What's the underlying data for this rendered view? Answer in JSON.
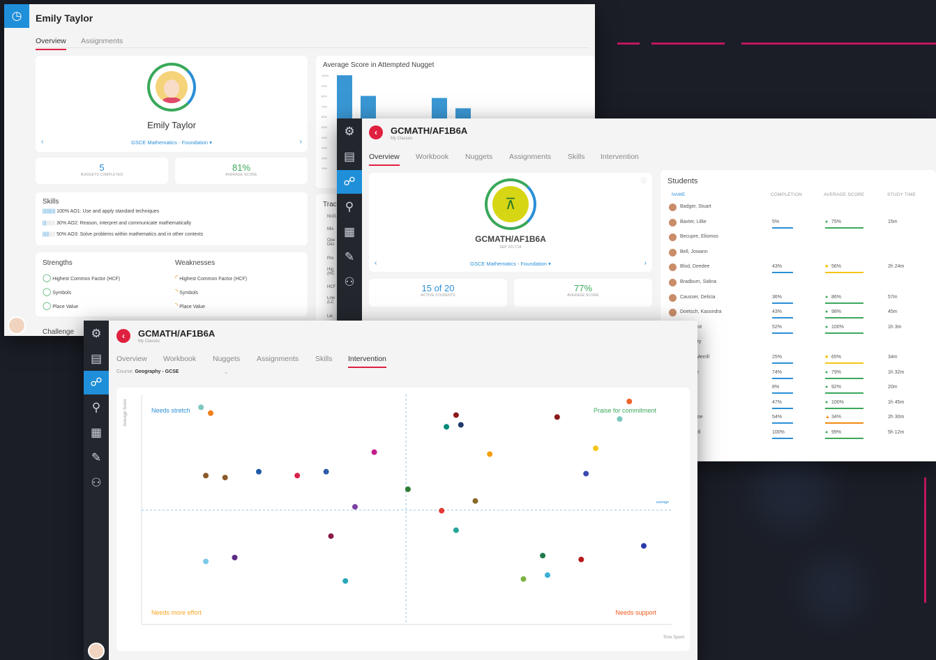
{
  "colors": {
    "accent": "#e0203f",
    "blue": "#2b8fd6",
    "green": "#3aa85a",
    "orange": "#f08c12"
  },
  "win1": {
    "title": "Emily Taylor",
    "tabs": [
      "Overview",
      "Assignments"
    ],
    "profile_name": "Emily Taylor",
    "course": "GSCE Mathematics - Foundation ▾",
    "stats": [
      {
        "value": "5",
        "label": "NUGGETS COMPLETED"
      },
      {
        "value": "81%",
        "label": "AVERAGE SCORE"
      }
    ],
    "skills_title": "Skills",
    "skills": [
      {
        "pct": "100%",
        "text": "AO1: Use and apply standard techniques"
      },
      {
        "pct": "30%",
        "text": "AO2: Reason, interpret and communicate mathematically"
      },
      {
        "pct": "50%",
        "text": "AO3: Solve problems within mathematics and in other contexts"
      }
    ],
    "strengths_title": "Strengths",
    "strengths": [
      "Highest Common Factor (HCF)",
      "Symbols",
      "Place Value"
    ],
    "weaknesses_title": "Weaknesses",
    "weaknesses": [
      "Highest Common Factor (HCF)",
      "Symbols",
      "Place Value"
    ],
    "challenge": "Challenge",
    "chart_title": "Average Score in Attempted Nugget",
    "chart_ticks": [
      "100%",
      "90%",
      "80%",
      "70%",
      "60%",
      "50%",
      "40%",
      "30%",
      "20%",
      "10%"
    ],
    "side_title": "Trac",
    "side_rows": [
      "NUG",
      "Mix",
      "Ope Dec",
      "Pre",
      "Hig (HC",
      "HCF",
      "Low (LC",
      "Lie"
    ]
  },
  "win2": {
    "title": "GCMATH/AF1B6A",
    "subtitle": "My Classes",
    "tabs": [
      "Overview",
      "Workbook",
      "Nuggets",
      "Assignments",
      "Skills",
      "Intervention"
    ],
    "class_name": "GCMATH/AF1B6A",
    "class_year": "SEP 2017/18",
    "course": "GSCE Mathematics - Foundation ▾",
    "stats": [
      {
        "value": "15 of 20",
        "label": "ACTIVE STUDENTS"
      },
      {
        "value": "77%",
        "label": "AVERAGE SCORE"
      }
    ],
    "students_title": "Students",
    "columns": [
      "NAME",
      "COMPLETION",
      "AVERAGE SCORE",
      "STUDY TIME"
    ],
    "students": [
      {
        "name": "Badger, Stuart",
        "comp": "",
        "score": "",
        "time": "",
        "st": ""
      },
      {
        "name": "Baxter, Lillie",
        "comp": "5%",
        "score": "75%",
        "time": "15m",
        "st": "green"
      },
      {
        "name": "Becupre, Eliomos",
        "comp": "",
        "score": "",
        "time": "",
        "st": ""
      },
      {
        "name": "Bell, Jowann",
        "comp": "",
        "score": "",
        "time": "",
        "st": ""
      },
      {
        "name": "Blod, Deedee",
        "comp": "43%",
        "score": "56%",
        "time": "2h 24m",
        "st": "yellow"
      },
      {
        "name": "Bradburn, Sidina",
        "comp": "",
        "score": "",
        "time": "",
        "st": ""
      },
      {
        "name": "Causser, Delicia",
        "comp": "36%",
        "score": "86%",
        "time": "57m",
        "st": "green"
      },
      {
        "name": "Doetsch, Kasondra",
        "comp": "43%",
        "score": "98%",
        "time": "45m",
        "st": "green"
      },
      {
        "name": "...ke, Scot",
        "comp": "52%",
        "score": "100%",
        "time": "1h 3m",
        "st": "green"
      },
      {
        "name": "...n, Barry",
        "comp": "",
        "score": "",
        "time": "",
        "st": ""
      },
      {
        "name": "...ding, Merrill",
        "comp": "25%",
        "score": "65%",
        "time": "34m",
        "st": "yellow"
      },
      {
        "name": "..., Liane",
        "comp": "74%",
        "score": "79%",
        "time": "1h 32m",
        "st": "green"
      },
      {
        "name": "Edward",
        "comp": "8%",
        "score": "92%",
        "time": "20m",
        "st": "green"
      },
      {
        "name": "...Kirk",
        "comp": "47%",
        "score": "100%",
        "time": "1h 45m",
        "st": "green"
      },
      {
        "name": "...ore, Noe",
        "comp": "54%",
        "score": "34%",
        "time": "2h 30m",
        "st": "orange"
      },
      {
        "name": "..., Jewell",
        "comp": "100%",
        "score": "99%",
        "time": "5h 12m",
        "st": "green"
      }
    ]
  },
  "win3": {
    "title": "GCMATH/AF1B6A",
    "subtitle": "My Classes",
    "tabs": [
      "Overview",
      "Workbook",
      "Nuggets",
      "Assignments",
      "Skills",
      "Intervention"
    ],
    "course_label": "Course:",
    "course_value": "Geography - GCSE",
    "y_label": "Average Score",
    "x_label": "Time Spent",
    "avg_label": "average",
    "quadrants": {
      "tl": "Needs stretch",
      "tr": "Praise for commitment",
      "bl": "Needs more effort",
      "br": "Needs support"
    }
  },
  "chart_data": [
    {
      "type": "bar",
      "title": "Average Score in Attempted Nugget",
      "ylim": [
        0,
        100
      ],
      "values": [
        100,
        80,
        50,
        0,
        78,
        68
      ]
    },
    {
      "type": "scatter",
      "xlabel": "Time Spent",
      "ylabel": "Average Score",
      "points": [
        {
          "x": 0.08,
          "y": 0.97,
          "c": "#7cc8c0"
        },
        {
          "x": 0.1,
          "y": 0.94,
          "c": "#f07f1d"
        },
        {
          "x": 0.09,
          "y": 0.62,
          "c": "#8a5a2a"
        },
        {
          "x": 0.13,
          "y": 0.61,
          "c": "#8a5a2a"
        },
        {
          "x": 0.2,
          "y": 0.64,
          "c": "#1f5aa8"
        },
        {
          "x": 0.28,
          "y": 0.62,
          "c": "#d6224a"
        },
        {
          "x": 0.34,
          "y": 0.64,
          "c": "#2a5ca8"
        },
        {
          "x": 0.4,
          "y": 0.46,
          "c": "#7a3fa0"
        },
        {
          "x": 0.44,
          "y": 0.74,
          "c": "#c21f8a"
        },
        {
          "x": 0.51,
          "y": 0.55,
          "c": "#2e7d32"
        },
        {
          "x": 0.59,
          "y": 0.87,
          "c": "#00897b"
        },
        {
          "x": 0.61,
          "y": 0.93,
          "c": "#8b1a1a"
        },
        {
          "x": 0.62,
          "y": 0.88,
          "c": "#1f3a6b"
        },
        {
          "x": 0.65,
          "y": 0.49,
          "c": "#8a6a2a"
        },
        {
          "x": 0.58,
          "y": 0.44,
          "c": "#e53935"
        },
        {
          "x": 0.61,
          "y": 0.34,
          "c": "#26a69a"
        },
        {
          "x": 0.68,
          "y": 0.73,
          "c": "#f59e0b"
        },
        {
          "x": 0.82,
          "y": 0.92,
          "c": "#8b1a1a"
        },
        {
          "x": 0.88,
          "y": 0.63,
          "c": "#3a4ab0"
        },
        {
          "x": 0.9,
          "y": 0.76,
          "c": "#f5c518"
        },
        {
          "x": 0.95,
          "y": 0.91,
          "c": "#7cc8c0"
        },
        {
          "x": 0.97,
          "y": 1.0,
          "c": "#f0642a"
        },
        {
          "x": 0.35,
          "y": 0.31,
          "c": "#8b1a4a"
        },
        {
          "x": 0.15,
          "y": 0.2,
          "c": "#5b2a86"
        },
        {
          "x": 0.09,
          "y": 0.18,
          "c": "#7cc8e8"
        },
        {
          "x": 0.38,
          "y": 0.08,
          "c": "#26a6b8"
        },
        {
          "x": 0.75,
          "y": 0.09,
          "c": "#7cb342"
        },
        {
          "x": 0.8,
          "y": 0.11,
          "c": "#3ab0d8"
        },
        {
          "x": 0.79,
          "y": 0.21,
          "c": "#1f7a4a"
        },
        {
          "x": 0.87,
          "y": 0.19,
          "c": "#b71c1c"
        },
        {
          "x": 1.0,
          "y": 0.26,
          "c": "#2a3aa8"
        }
      ]
    }
  ]
}
